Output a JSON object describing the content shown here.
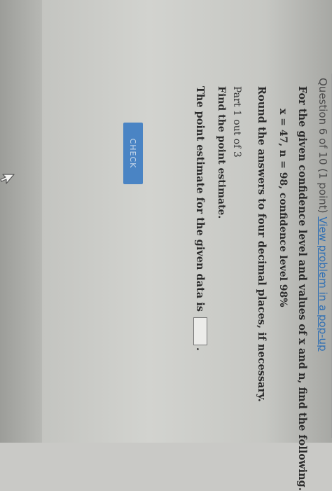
{
  "header": {
    "question_label": "Question 6 of 10 (1 point)",
    "popup_link": "View problem in a pop-up"
  },
  "problem": {
    "prompt": "For the given confidence level and values of x and n, find the following.",
    "values": "x = 47, n = 98, confidence level 98%",
    "rounding": "Round the answers to four decimal places, if necessary."
  },
  "part": {
    "label": "Part 1 out of 3",
    "instruction": "Find the point estimate.",
    "estimate_text": "The point estimate for the given data is",
    "answer_value": "",
    "period": "."
  },
  "buttons": {
    "check_label": "Check"
  },
  "icons": {
    "cursor": "mouse-pointer-icon"
  },
  "colors": {
    "link": "#2f6fb3",
    "check_button": "#4a84c4"
  }
}
